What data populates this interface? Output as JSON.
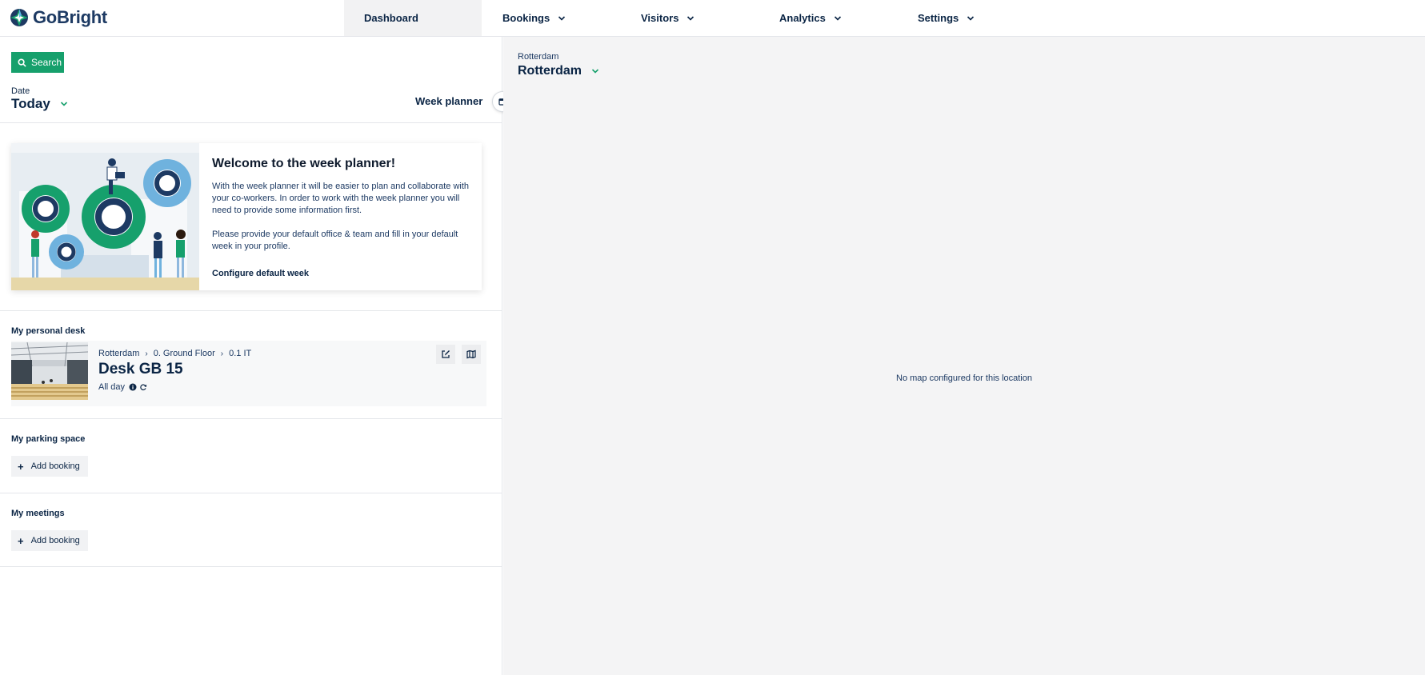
{
  "app": {
    "name": "GoBright"
  },
  "nav": {
    "dashboard": "Dashboard",
    "bookings": "Bookings",
    "visitors": "Visitors",
    "analytics": "Analytics",
    "settings": "Settings"
  },
  "left": {
    "search_label": "Search",
    "date_label": "Date",
    "date_value": "Today",
    "week_planner": "Week planner"
  },
  "welcome": {
    "title": "Welcome to the week planner!",
    "paragraph1": "With the week planner it will be easier to plan and collaborate with your co-workers. In order to work with the week planner you will need to provide some information first.",
    "paragraph2": "Please provide your default office & team and fill in your default week in your profile.",
    "link": "Configure default week"
  },
  "personal_desk": {
    "title": "My personal desk",
    "breadcrumb": [
      "Rotterdam",
      "0. Ground Floor",
      "0.1 IT"
    ],
    "name": "Desk GB 15",
    "time": "All day"
  },
  "parking": {
    "title": "My parking space",
    "add_label": "Add booking"
  },
  "meetings": {
    "title": "My meetings",
    "add_label": "Add booking"
  },
  "right": {
    "location_label": "Rotterdam",
    "location_value": "Rotterdam",
    "no_map": "No map configured for this location"
  },
  "colors": {
    "accent": "#16a06c",
    "navy": "#0b2545",
    "panel_bg": "#f4f4f5"
  },
  "icons": {
    "logo": "gobright-logo-icon",
    "search": "search-icon",
    "calendar": "calendar-icon",
    "edit": "edit-icon",
    "map": "map-icon",
    "info": "info-icon",
    "recurring": "recurring-icon",
    "chevron": "chevron-down-icon"
  }
}
